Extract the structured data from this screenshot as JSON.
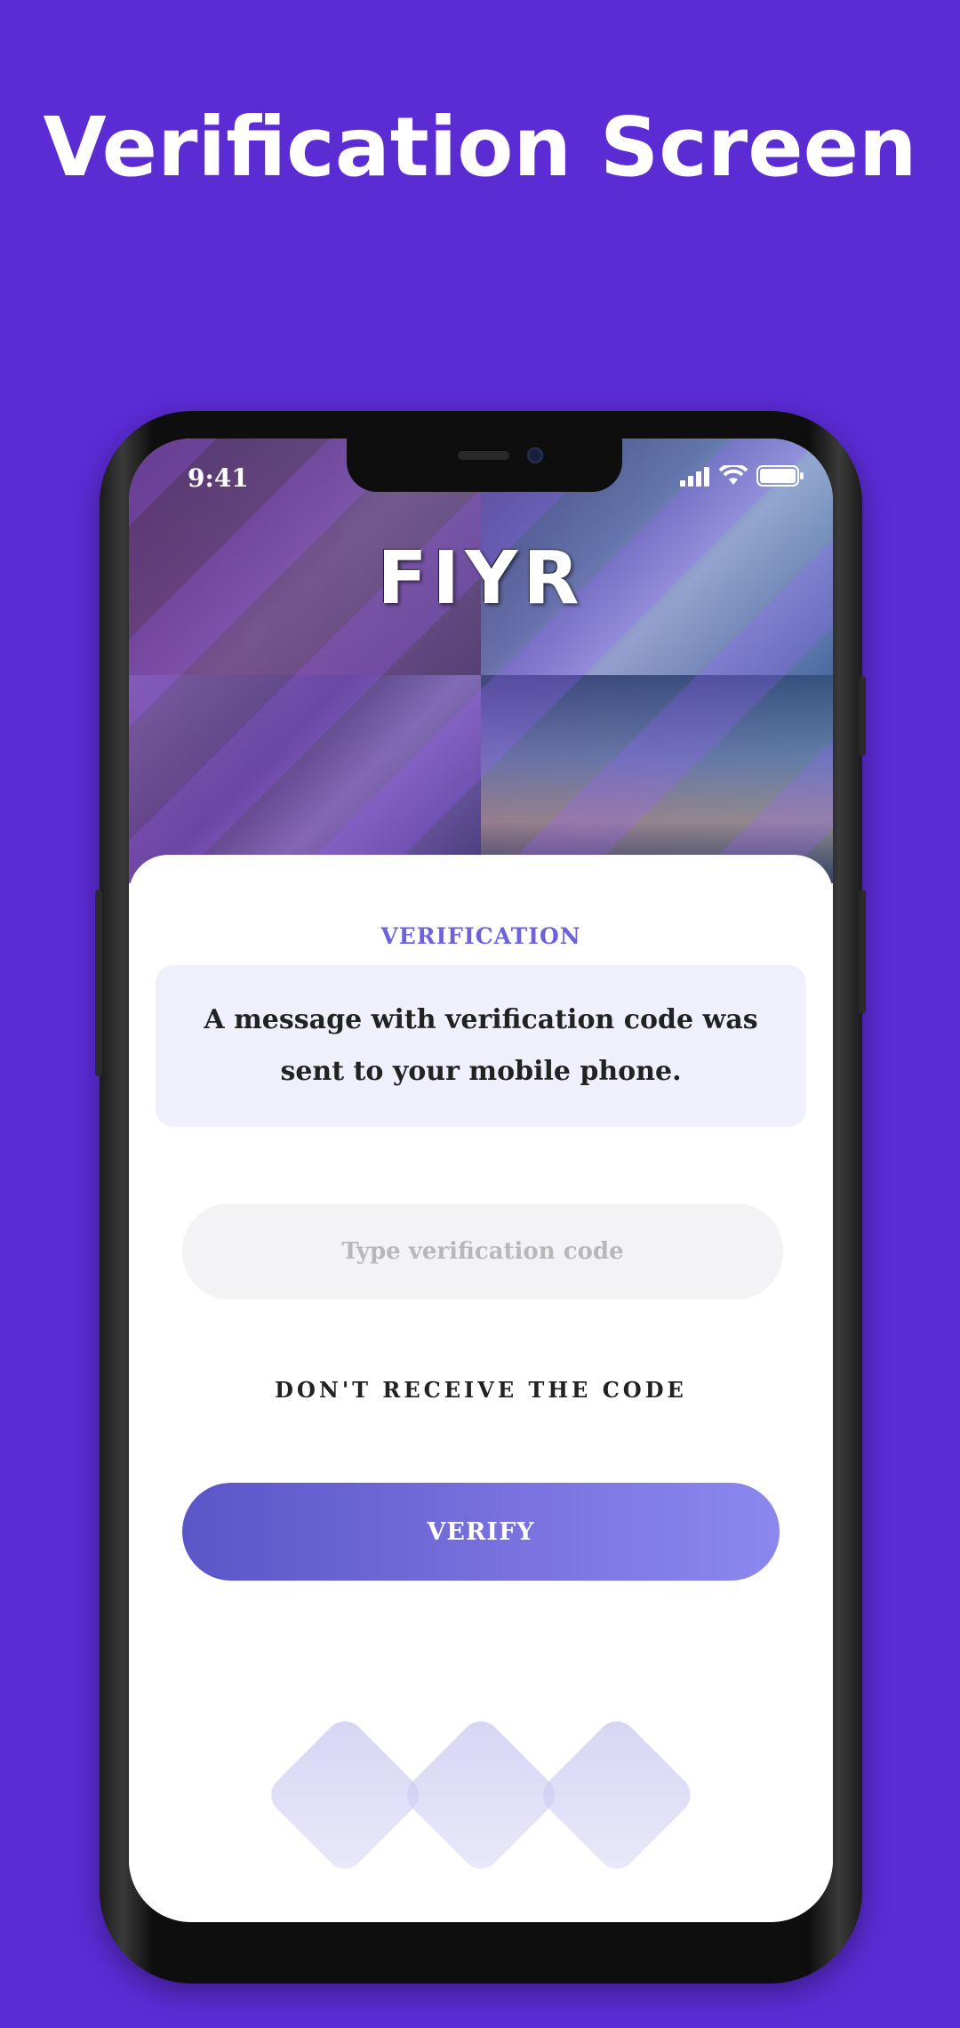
{
  "page": {
    "headline": "Verification Screen",
    "background": "#5b2bd4"
  },
  "status_bar": {
    "time": "9:41"
  },
  "app": {
    "logo": "FIYR"
  },
  "verification": {
    "title": "VERIFICATION",
    "message": "A message with verification code was sent to your mobile phone.",
    "code_input": {
      "value": "",
      "placeholder": "Type verification code"
    },
    "resend_link": "DON'T RECEIVE THE CODE",
    "verify_button": "VERIFY"
  },
  "colors": {
    "accent": "#6c63d9",
    "button_start": "#5a56c8",
    "button_end": "#8a88ee",
    "message_bg": "#f0f0fc"
  },
  "icons": [
    "signal-icon",
    "wifi-icon",
    "battery-icon"
  ]
}
